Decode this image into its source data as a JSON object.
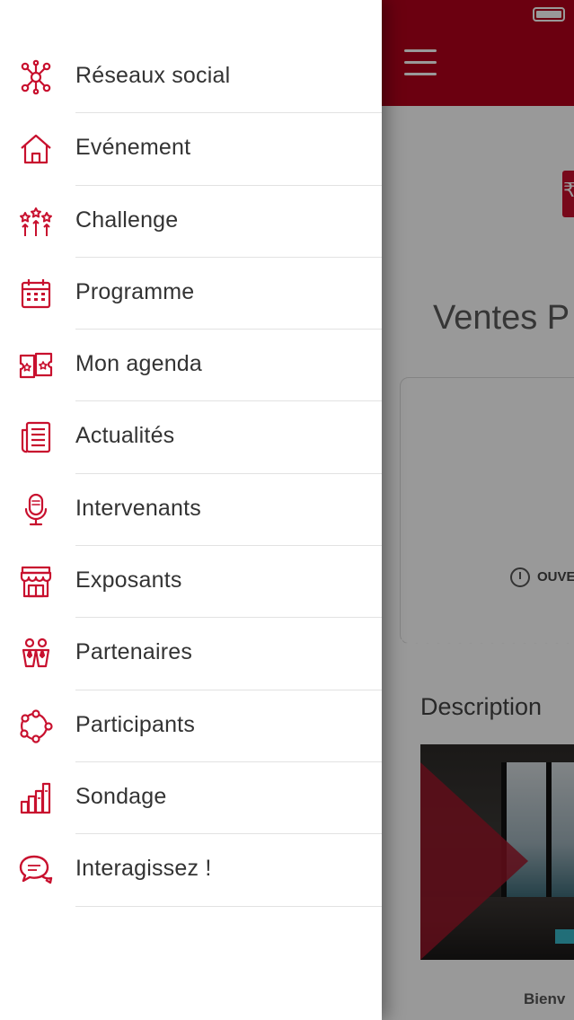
{
  "colors": {
    "accent": "#c8102e",
    "header_bg": "#b3001b",
    "text": "#333333",
    "divider": "#e2e2e2"
  },
  "drawer": {
    "items": [
      {
        "label": "Réseaux social",
        "icon": "network-icon"
      },
      {
        "label": "Evénement",
        "icon": "home-icon"
      },
      {
        "label": "Challenge",
        "icon": "fireworks-icon"
      },
      {
        "label": "Programme",
        "icon": "calendar-icon"
      },
      {
        "label": "Mon agenda",
        "icon": "tickets-icon"
      },
      {
        "label": "Actualités",
        "icon": "newspaper-icon"
      },
      {
        "label": "Intervenants",
        "icon": "microphone-icon"
      },
      {
        "label": "Exposants",
        "icon": "store-icon"
      },
      {
        "label": "Partenaires",
        "icon": "partners-icon"
      },
      {
        "label": "Participants",
        "icon": "participants-icon"
      },
      {
        "label": "Sondage",
        "icon": "bar-chart-icon"
      },
      {
        "label": "Interagissez !",
        "icon": "chat-bubbles-icon"
      }
    ]
  },
  "background": {
    "event_title": "Ventes P",
    "status_label": "OUVE",
    "section_title": "Description",
    "welcome_text": "Bienv"
  }
}
